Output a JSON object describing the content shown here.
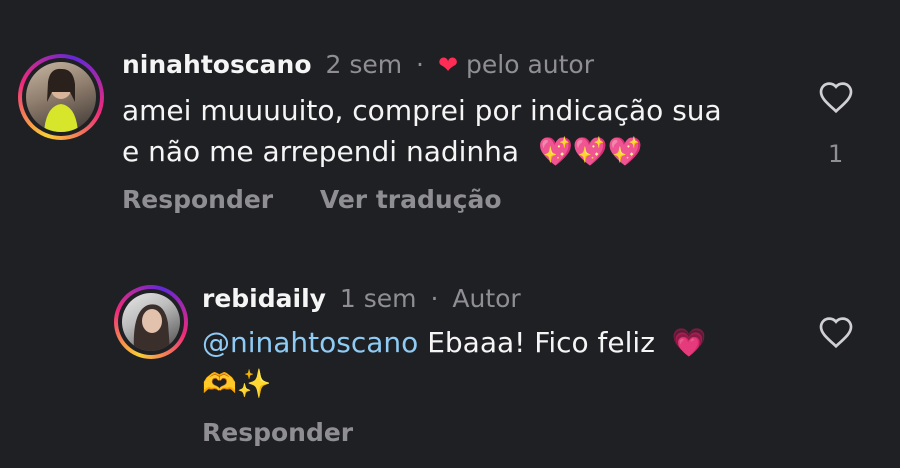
{
  "comments": [
    {
      "username": "ninahtoscano",
      "time": "2 sem",
      "separator": "·",
      "liked_by_author_icon": "heart-filled-red",
      "liked_by_author_label": "pelo autor",
      "text_line1": "amei muuuuito, comprei por indicação sua",
      "text_line2": "e não me arrependi nadinha",
      "emojis": "💖💖💖",
      "reply_label": "Responder",
      "translate_label": "Ver tradução",
      "like_icon": "heart-outline",
      "like_count": "1"
    },
    {
      "username": "rebidaily",
      "time": "1 sem",
      "separator": "·",
      "author_label": "Autor",
      "mention": "@ninahtoscano",
      "text": "Ebaaa! Fico feliz",
      "emoji_inline": "💗",
      "emojis_line2": "🫶✨",
      "reply_label": "Responder",
      "like_icon": "heart-outline"
    }
  ],
  "colors": {
    "background": "#1f2024",
    "text": "#f5f5f5",
    "muted": "#8e8e93",
    "mention": "#8ecbf5",
    "heart": "#ff2d55"
  }
}
